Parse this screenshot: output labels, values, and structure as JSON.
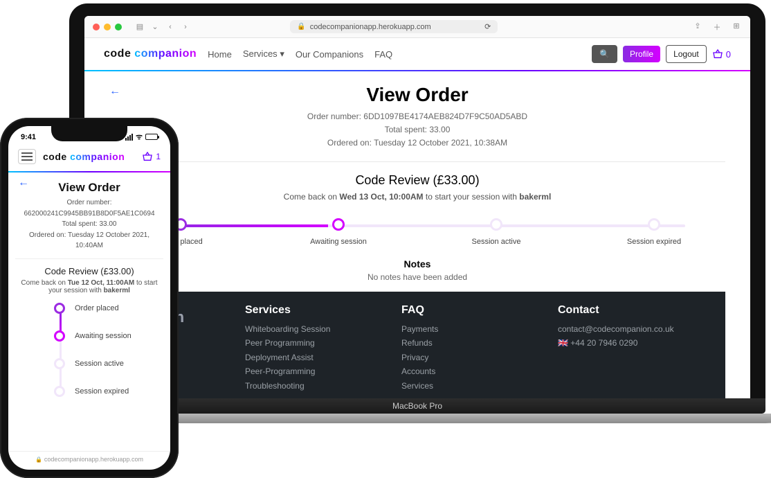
{
  "browser": {
    "url": "codecompanionapp.herokuapp.com"
  },
  "brand": {
    "code": "code",
    "companion": "companion"
  },
  "nav": {
    "home": "Home",
    "services": "Services",
    "our_companions": "Our Companions",
    "faq": "FAQ",
    "profile": "Profile",
    "logout": "Logout",
    "basket_count": "0"
  },
  "page": {
    "title": "View Order",
    "order_number_label": "Order number:",
    "order_number": "6DD1097BE4174AEB824D7F9C50AD5ABD",
    "total_label": "Total spent:",
    "total": "33.00",
    "ordered_label": "Ordered on:",
    "ordered": "Tuesday 12 October 2021, 10:38AM",
    "service_name": "Code Review",
    "service_price": "(£33.00)",
    "comeback_pre": "Come back on ",
    "comeback_bold": "Wed 13 Oct, 10:00AM",
    "comeback_mid": " to start your session with ",
    "comeback_user": "bakerml",
    "steps": [
      "Order placed",
      "Awaiting session",
      "Session active",
      "Session expired"
    ],
    "notes_h": "Notes",
    "notes_p": "No notes have been added"
  },
  "footer": {
    "brand_fragment": "panion",
    "services_h": "Services",
    "services": [
      "Whiteboarding Session",
      "Peer Programming",
      "Deployment Assist",
      "Peer-Programming",
      "Troubleshooting"
    ],
    "faq_h": "FAQ",
    "faq": [
      "Payments",
      "Refunds",
      "Privacy",
      "Accounts",
      "Services"
    ],
    "contact_h": "Contact",
    "contact_email": "contact@codecompanion.co.uk",
    "contact_phone": "🇬🇧 +44 20 7946 0290"
  },
  "phone": {
    "time": "9:41",
    "basket_count": "1",
    "title": "View Order",
    "order_number_label": "Order number:",
    "order_number": "662000241C9945BB91B8D0F5AE1C0694",
    "total_label": "Total spent:",
    "total": "33.00",
    "ordered_label": "Ordered on:",
    "ordered": "Tuesday 12 October 2021, 10:40AM",
    "service_name": "Code Review",
    "service_price": "(£33.00)",
    "comeback_pre": "Come back on ",
    "comeback_bold": "Tue 12 Oct, 11:00AM",
    "comeback_mid": " to start your session with ",
    "comeback_user": "bakerml",
    "steps": [
      "Order placed",
      "Awaiting session",
      "Session active",
      "Session expired"
    ],
    "url": "codecompanionapp.herokuapp.com"
  },
  "laptop_label": "MacBook Pro"
}
